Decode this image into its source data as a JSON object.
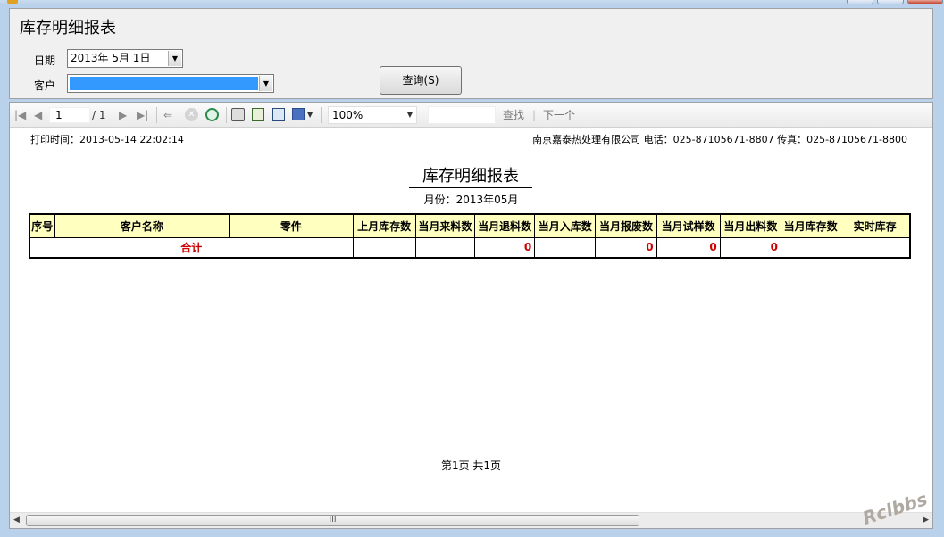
{
  "form": {
    "title": "库存明细报表",
    "date_label": "日期",
    "date_value": "2013年  5月  1日",
    "customer_label": "客户",
    "customer_value": "",
    "query_button": "查询(S)"
  },
  "toolbar": {
    "first_page_icon": "first-page-icon",
    "prev_page_icon": "prev-page-icon",
    "current_page": "1",
    "total_pages": "/ 1",
    "next_page_icon": "next-page-icon",
    "last_page_icon": "last-page-icon",
    "zoom": "100%",
    "find_value": "",
    "find_label": "查找",
    "find_sep": "|",
    "next_label": "下一个"
  },
  "report": {
    "print_time": "打印时间：2013-05-14 22:02:14",
    "company_info": "南京嘉泰热处理有限公司    电话：025-87105671-8807 传真：025-87105671-8800",
    "title": "库存明细报表",
    "month": "月份：2013年05月",
    "columns": [
      "序号",
      "客户名称",
      "零件",
      "上月库存数",
      "当月来料数",
      "当月退料数",
      "当月入库数",
      "当月报废数",
      "当月试样数",
      "当月出料数",
      "当月库存数",
      "实时库存"
    ],
    "total_row": {
      "label": "合计",
      "last_month_stock": "",
      "received": "",
      "returned": "0",
      "stocked_in": "",
      "scrapped": "0",
      "samples": "0",
      "shipped": "0",
      "month_stock": "",
      "live_stock": ""
    },
    "footer": "第1页   共1页"
  },
  "scrollbar": {
    "grip": "III"
  },
  "watermark": "Rclbbs",
  "colors": {
    "header_fill": "#ffffc0",
    "total_text": "#cc0000",
    "selection": "#3399ff"
  }
}
